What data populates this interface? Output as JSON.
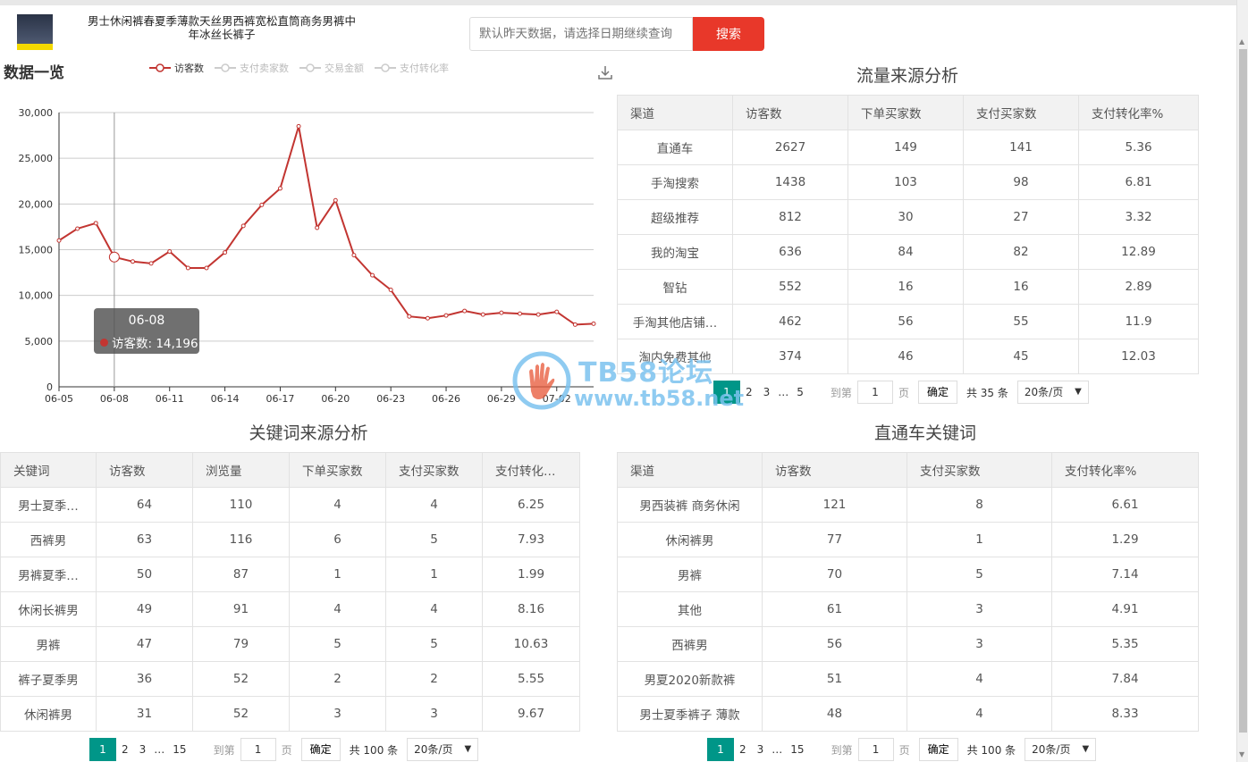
{
  "header": {
    "product_title": "男士休闲裤春夏季薄款天丝男西裤宽松直筒商务男裤中年冰丝长裤子",
    "search_placeholder": "默认昨天数据，请选择日期继续查询",
    "search_button": "搜索"
  },
  "overview": {
    "title": "数据一览",
    "legend": [
      "访客数",
      "支付卖家数",
      "交易金额",
      "支付转化率"
    ],
    "tooltip": {
      "date": "06-08",
      "label": "访客数: 14,196"
    }
  },
  "chart_data": {
    "type": "line",
    "title": "",
    "x": [
      "06-05",
      "06-06",
      "06-07",
      "06-08",
      "06-09",
      "06-10",
      "06-11",
      "06-12",
      "06-13",
      "06-14",
      "06-15",
      "06-16",
      "06-17",
      "06-18",
      "06-19",
      "06-20",
      "06-21",
      "06-22",
      "06-23",
      "06-24",
      "06-25",
      "06-26",
      "06-27",
      "06-28",
      "06-29",
      "06-30",
      "07-01",
      "07-02",
      "07-03",
      "07-04"
    ],
    "x_tick_labels": [
      "06-05",
      "06-08",
      "06-11",
      "06-14",
      "06-17",
      "06-20",
      "06-23",
      "06-26",
      "06-29",
      "07-02"
    ],
    "series": [
      {
        "name": "访客数",
        "values": [
          16000,
          17300,
          17900,
          14196,
          13700,
          13500,
          14800,
          13000,
          13000,
          14700,
          17600,
          19900,
          21700,
          28500,
          17400,
          20400,
          14400,
          12200,
          10600,
          7700,
          7500,
          7800,
          8300,
          7900,
          8100,
          8000,
          7900,
          8200,
          6800,
          6900
        ]
      }
    ],
    "y_ticks": [
      "30,000",
      "25,000",
      "20,000",
      "15,000",
      "10,000",
      "5,000",
      "0"
    ],
    "ylim": [
      0,
      30000
    ],
    "grid": true,
    "highlight_index": 3
  },
  "traffic_source": {
    "title": "流量来源分析",
    "headers": [
      "渠道",
      "访客数",
      "下单买家数",
      "支付买家数",
      "支付转化率%"
    ],
    "rows": [
      [
        "直通车",
        "2627",
        "149",
        "141",
        "5.36"
      ],
      [
        "手淘搜索",
        "1438",
        "103",
        "98",
        "6.81"
      ],
      [
        "超级推荐",
        "812",
        "30",
        "27",
        "3.32"
      ],
      [
        "我的淘宝",
        "636",
        "84",
        "82",
        "12.89"
      ],
      [
        "智钻",
        "552",
        "16",
        "16",
        "2.89"
      ],
      [
        "手淘其他店铺…",
        "462",
        "56",
        "55",
        "11.9"
      ],
      [
        "淘内免费其他",
        "374",
        "46",
        "45",
        "12.03"
      ]
    ],
    "pager": {
      "pages": [
        "1",
        "2",
        "3",
        "5"
      ],
      "ellipsis": "…",
      "goto_label": "到第",
      "page_value": "1",
      "page_unit": "页",
      "confirm": "确定",
      "total": "共 35 条",
      "page_size": "20条/页"
    }
  },
  "keyword_source": {
    "title": "关键词来源分析",
    "headers": [
      "关键词",
      "访客数",
      "浏览量",
      "下单买家数",
      "支付买家数",
      "支付转化…"
    ],
    "rows": [
      [
        "男士夏季…",
        "64",
        "110",
        "4",
        "4",
        "6.25"
      ],
      [
        "西裤男",
        "63",
        "116",
        "6",
        "5",
        "7.93"
      ],
      [
        "男裤夏季…",
        "50",
        "87",
        "1",
        "1",
        "1.99"
      ],
      [
        "休闲长裤男",
        "49",
        "91",
        "4",
        "4",
        "8.16"
      ],
      [
        "男裤",
        "47",
        "79",
        "5",
        "5",
        "10.63"
      ],
      [
        "裤子夏季男",
        "36",
        "52",
        "2",
        "2",
        "5.55"
      ],
      [
        "休闲裤男",
        "31",
        "52",
        "3",
        "3",
        "9.67"
      ]
    ],
    "pager": {
      "pages": [
        "1",
        "2",
        "3",
        "15"
      ],
      "ellipsis": "…",
      "goto_label": "到第",
      "page_value": "1",
      "page_unit": "页",
      "confirm": "确定",
      "total": "共 100 条",
      "page_size": "20条/页"
    }
  },
  "ztc_keywords": {
    "title": "直通车关键词",
    "headers": [
      "渠道",
      "访客数",
      "支付买家数",
      "支付转化率%"
    ],
    "rows": [
      [
        "男西装裤 商务休闲",
        "121",
        "8",
        "6.61"
      ],
      [
        "休闲裤男",
        "77",
        "1",
        "1.29"
      ],
      [
        "男裤",
        "70",
        "5",
        "7.14"
      ],
      [
        "其他",
        "61",
        "3",
        "4.91"
      ],
      [
        "西裤男",
        "56",
        "3",
        "5.35"
      ],
      [
        "男夏2020新款裤",
        "51",
        "4",
        "7.84"
      ],
      [
        "男士夏季裤子 薄款",
        "48",
        "4",
        "8.33"
      ]
    ],
    "pager": {
      "pages": [
        "1",
        "2",
        "3",
        "15"
      ],
      "ellipsis": "…",
      "goto_label": "到第",
      "page_value": "1",
      "page_unit": "页",
      "confirm": "确定",
      "total": "共 100 条",
      "page_size": "20条/页"
    }
  },
  "watermark": {
    "text": "TB58论坛",
    "url": "www.tb58.net"
  },
  "colors": {
    "accent": "#c23531",
    "search": "#e8382a",
    "pager_current": "#009688"
  }
}
